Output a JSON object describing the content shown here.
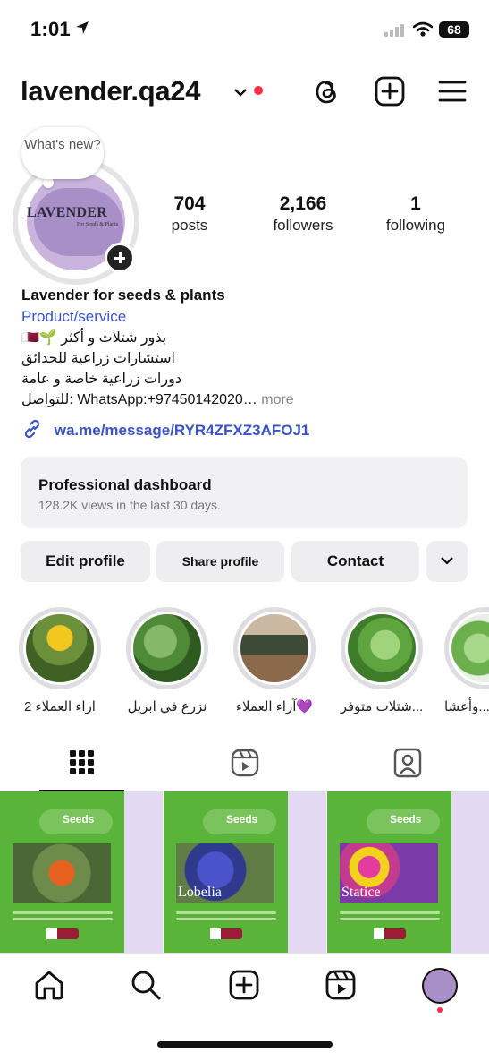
{
  "status_bar": {
    "time": "1:01",
    "battery": "68"
  },
  "header": {
    "username": "lavender.qa24"
  },
  "profile": {
    "bubble_text": "What's new?",
    "avatar_title": "LAVENDER",
    "avatar_subtitle": "For Seeds & Plants",
    "stats": [
      {
        "num": "704",
        "label": "posts"
      },
      {
        "num": "2,166",
        "label": "followers"
      },
      {
        "num": "1",
        "label": "following"
      }
    ]
  },
  "bio": {
    "name": "Lavender for seeds & plants",
    "category": "Product/service",
    "lines": [
      "بذور شتلات و أكثر 🌱🇶🇦",
      "استشارات زراعية للحدائق",
      "دورات زراعية خاصة و عامة"
    ],
    "contact": "للتواصل: WhatsApp:+97450142020…",
    "more": "more",
    "link": "wa.me/message/RYR4ZFXZ3AFOJ1"
  },
  "dashboard": {
    "title": "Professional dashboard",
    "subtitle": "128.2K views in the last 30 days."
  },
  "buttons": {
    "edit": "Edit profile",
    "share": "Share profile",
    "contact": "Contact"
  },
  "highlights": [
    {
      "label": "اراء العملاء 2"
    },
    {
      "label": "نزرع في ابريل"
    },
    {
      "label": "آراء العملاء💜"
    },
    {
      "label": "شتلات متوفر..."
    },
    {
      "label": "وأعشا..."
    }
  ],
  "posts": [
    {
      "brand": "Seeds",
      "caption": ""
    },
    {
      "brand": "Seeds",
      "caption": "Lobelia"
    },
    {
      "brand": "Seeds",
      "caption": "Statice"
    }
  ],
  "colors": {
    "link_blue": "#3b53c7",
    "notification_red": "#ff2d45",
    "brand_lavender": "#a88fc7",
    "post_green": "#5bb43a"
  }
}
